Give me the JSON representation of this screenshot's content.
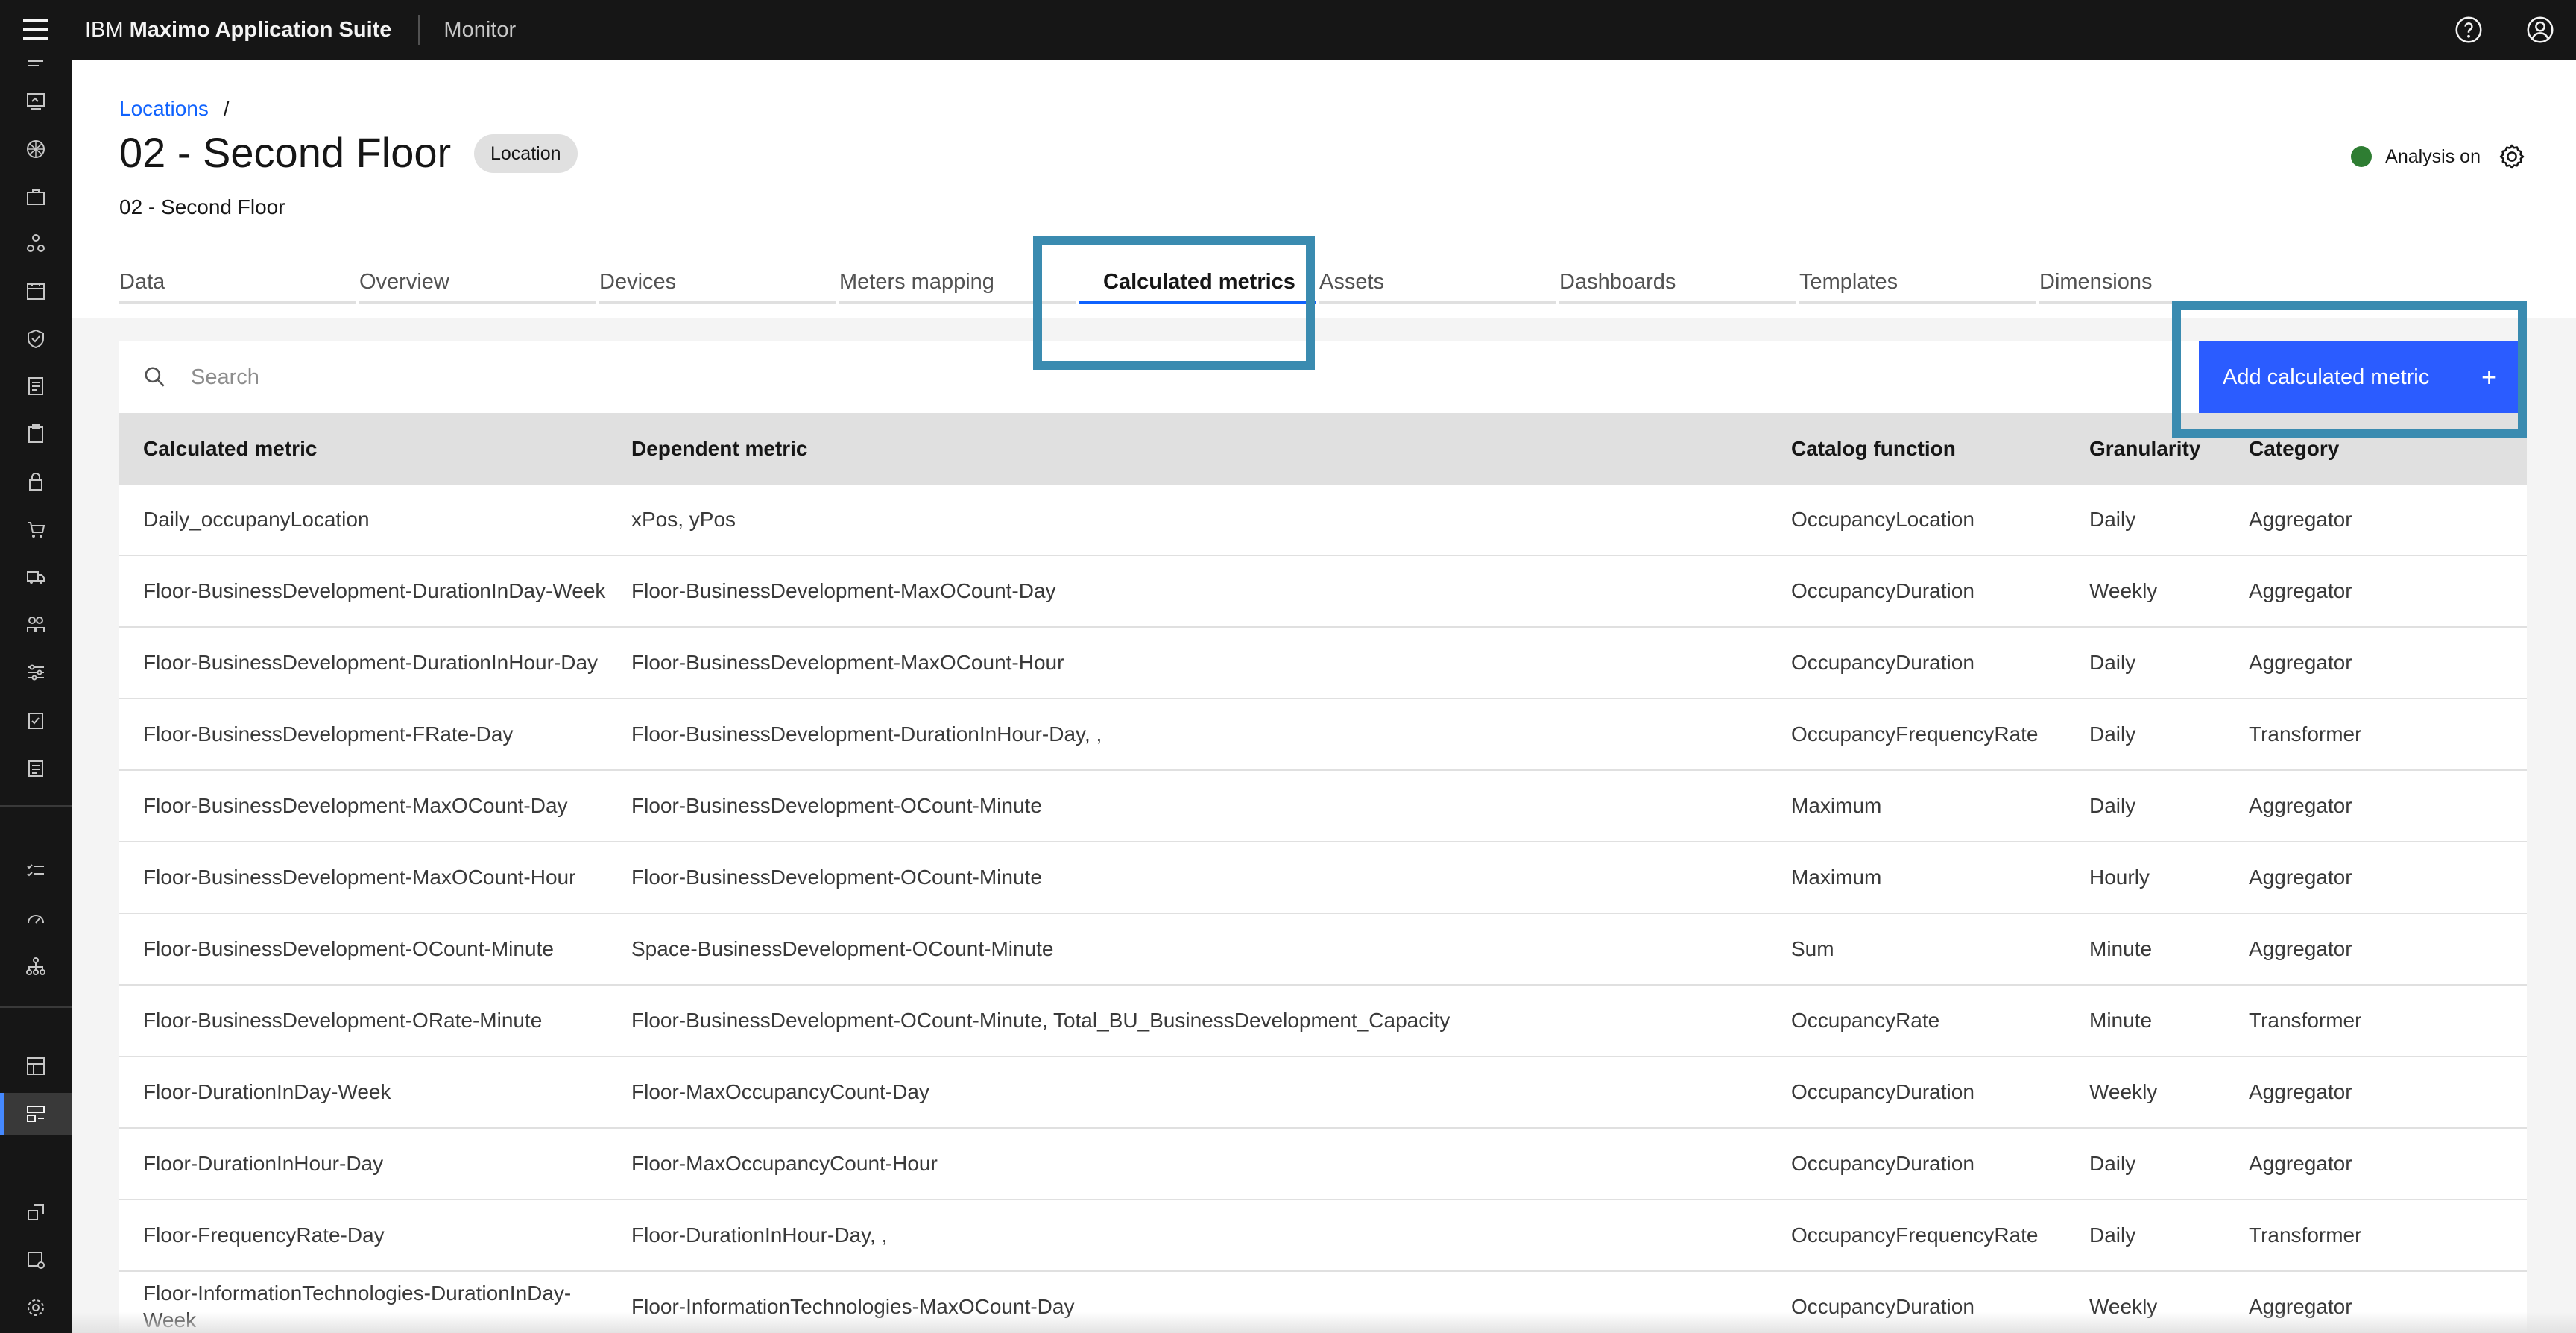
{
  "header": {
    "brand_prefix": "IBM",
    "brand_name": "Maximo Application Suite",
    "product": "Monitor"
  },
  "breadcrumb": {
    "link": "Locations",
    "separator": "/"
  },
  "page": {
    "title": "02 - Second Floor",
    "tag": "Location",
    "subtitle": "02 - Second Floor",
    "analysis_status": "Analysis on",
    "status_color": "#2e7d32"
  },
  "tabs": [
    {
      "label": "Data"
    },
    {
      "label": "Overview"
    },
    {
      "label": "Devices"
    },
    {
      "label": "Meters mapping"
    },
    {
      "label": "Calculated metrics"
    },
    {
      "label": "Assets"
    },
    {
      "label": "Dashboards"
    },
    {
      "label": "Templates"
    },
    {
      "label": "Dimensions"
    }
  ],
  "selected_tab": "Calculated metrics",
  "search": {
    "placeholder": "Search"
  },
  "add_button": {
    "label": "Add calculated metric",
    "icon": "+"
  },
  "table": {
    "headers": [
      "Calculated metric",
      "Dependent metric",
      "Catalog function",
      "Granularity",
      "Category"
    ],
    "rows": [
      [
        "Daily_occupanyLocation",
        "xPos, yPos",
        "OccupancyLocation",
        "Daily",
        "Aggregator"
      ],
      [
        "Floor-BusinessDevelopment-DurationInDay-Week",
        "Floor-BusinessDevelopment-MaxOCount-Day",
        "OccupancyDuration",
        "Weekly",
        "Aggregator"
      ],
      [
        "Floor-BusinessDevelopment-DurationInHour-Day",
        "Floor-BusinessDevelopment-MaxOCount-Hour",
        "OccupancyDuration",
        "Daily",
        "Aggregator"
      ],
      [
        "Floor-BusinessDevelopment-FRate-Day",
        "Floor-BusinessDevelopment-DurationInHour-Day, ,",
        "OccupancyFrequencyRate",
        "Daily",
        "Transformer"
      ],
      [
        "Floor-BusinessDevelopment-MaxOCount-Day",
        "Floor-BusinessDevelopment-OCount-Minute",
        "Maximum",
        "Daily",
        "Aggregator"
      ],
      [
        "Floor-BusinessDevelopment-MaxOCount-Hour",
        "Floor-BusinessDevelopment-OCount-Minute",
        "Maximum",
        "Hourly",
        "Aggregator"
      ],
      [
        "Floor-BusinessDevelopment-OCount-Minute",
        "Space-BusinessDevelopment-OCount-Minute",
        "Sum",
        "Minute",
        "Aggregator"
      ],
      [
        "Floor-BusinessDevelopment-ORate-Minute",
        "Floor-BusinessDevelopment-OCount-Minute, Total_BU_BusinessDevelopment_Capacity",
        "OccupancyRate",
        "Minute",
        "Transformer"
      ],
      [
        "Floor-DurationInDay-Week",
        "Floor-MaxOccupancyCount-Day",
        "OccupancyDuration",
        "Weekly",
        "Aggregator"
      ],
      [
        "Floor-DurationInHour-Day",
        "Floor-MaxOccupancyCount-Hour",
        "OccupancyDuration",
        "Daily",
        "Aggregator"
      ],
      [
        "Floor-FrequencyRate-Day",
        "Floor-DurationInHour-Day, ,",
        "OccupancyFrequencyRate",
        "Daily",
        "Transformer"
      ],
      [
        "Floor-InformationTechnologies-DurationInDay-Week",
        "Floor-InformationTechnologies-MaxOCount-Day",
        "OccupancyDuration",
        "Weekly",
        "Aggregator"
      ]
    ]
  },
  "icons": {
    "menu": "hamburger-menu-icon",
    "help": "help-icon",
    "user": "user-avatar-icon",
    "settings": "gear-icon",
    "search": "search-icon"
  }
}
